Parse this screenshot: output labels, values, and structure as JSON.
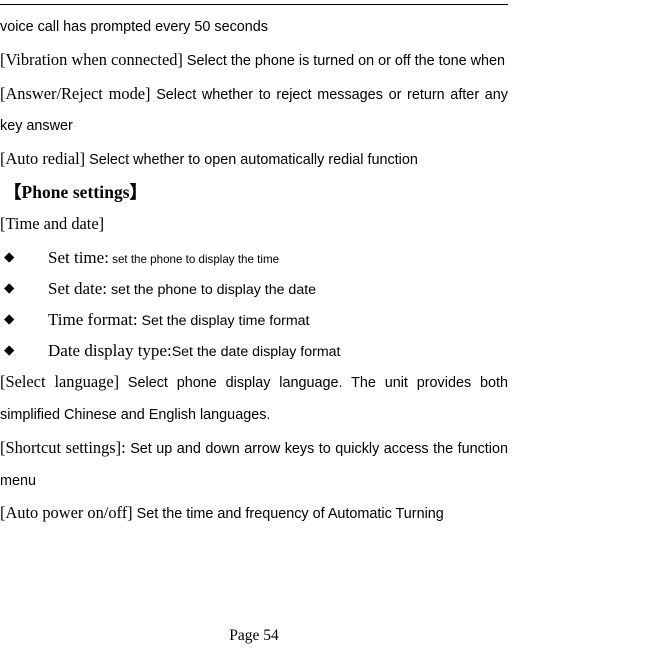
{
  "document": {
    "page_label": "Page 54",
    "bullet_glyph": "◆"
  },
  "paragraphs": [
    {
      "id": "voice-call-prompt",
      "term": "",
      "body": "voice call has prompted every 50 seconds",
      "justified": false
    },
    {
      "id": "vibration-when-connected",
      "term": "[Vibration when connected]",
      "body": " Select the phone is turned on or off the tone when",
      "justified": true
    },
    {
      "id": "answer-reject-mode",
      "term": "[Answer/Reject mode]",
      "body": " Select whether to reject messages or return after any key answer",
      "justified": true
    },
    {
      "id": "auto-redial",
      "term": "[Auto redial]",
      "body": " Select whether to open automatically redial function",
      "justified": false
    }
  ],
  "section": {
    "heading": "【Phone settings】",
    "subheading": "[Time and date]",
    "items": [
      {
        "term": "Set time:",
        "desc": " set the phone to display the time",
        "small": true
      },
      {
        "term": "Set date:",
        "desc": " set the phone to display the date",
        "small": false
      },
      {
        "term": "Time format:",
        "desc": " Set the display time format",
        "small": false
      },
      {
        "term": "Date display type:",
        "desc": "Set the date display format",
        "small": false
      }
    ]
  },
  "paragraphs_after": [
    {
      "id": "select-language",
      "term": "[Select language]",
      "body": " Select phone display language. The unit provides both simplified Chinese and English languages.",
      "justified": true
    },
    {
      "id": "shortcut-settings",
      "term": "[Shortcut settings]:",
      "body": " Set up and down arrow keys to quickly access the function menu",
      "justified": true
    },
    {
      "id": "auto-power-on-off",
      "term": "[Auto power on/off]",
      "body": " Set the time and frequency of Automatic Turning",
      "justified": true
    }
  ]
}
